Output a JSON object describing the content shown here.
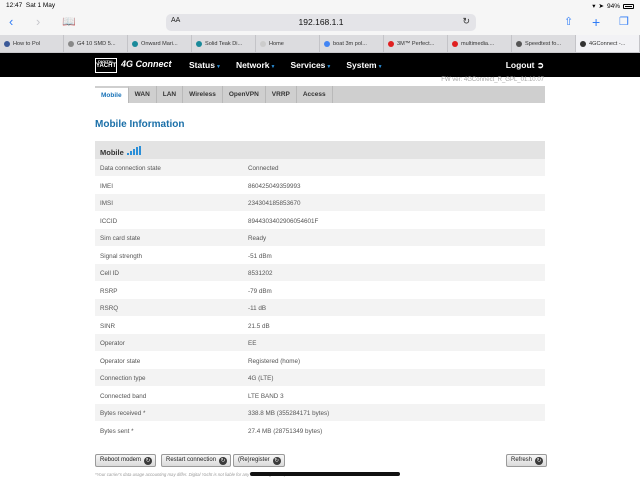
{
  "status_bar": {
    "time": "12:47",
    "date": "Sat 1 May",
    "battery": "94%"
  },
  "browser": {
    "text_size_label": "AA",
    "url": "192.168.1.1",
    "tabs": [
      {
        "label": "How to Pol",
        "color": "#3b5998"
      },
      {
        "label": "G4 10 SMD 5...",
        "color": "#888888"
      },
      {
        "label": "Onward Mari...",
        "color": "#1a8a9a"
      },
      {
        "label": "Solid Teak Di...",
        "color": "#1a8a9a"
      },
      {
        "label": "Home",
        "color": "#cccccc"
      },
      {
        "label": "boat 3m pol...",
        "color": "#4285f4"
      },
      {
        "label": "3M™ Perfect...",
        "color": "#e02020"
      },
      {
        "label": "multimedia....",
        "color": "#e02020"
      },
      {
        "label": "Speedtest fo...",
        "color": "#555555"
      },
      {
        "label": "4GConnect -...",
        "color": "#333333"
      }
    ]
  },
  "router": {
    "logo_top": "DIGITAL",
    "logo_bottom": "YACHT",
    "brand": "4G Connect",
    "menu": [
      "Status",
      "Network",
      "Services",
      "System"
    ],
    "logout": "Logout",
    "firmware": "FW ver: 4GConnect_R_GPL_01.10.07",
    "tabs": [
      "Mobile",
      "WAN",
      "LAN",
      "Wireless",
      "OpenVPN",
      "VRRP",
      "Access"
    ],
    "title": "Mobile Information",
    "section_label": "Mobile",
    "rows": [
      {
        "key": "Data connection state",
        "value": "Connected"
      },
      {
        "key": "IMEI",
        "value": "860425049359993"
      },
      {
        "key": "IMSI",
        "value": "234304185853670"
      },
      {
        "key": "ICCID",
        "value": "894430340290605460​1F"
      },
      {
        "key": "Sim card state",
        "value": "Ready"
      },
      {
        "key": "Signal strength",
        "value": "-51 dBm"
      },
      {
        "key": "Cell ID",
        "value": "8531202"
      },
      {
        "key": "RSRP",
        "value": "-79 dBm"
      },
      {
        "key": "RSRQ",
        "value": "-11 dB"
      },
      {
        "key": "SINR",
        "value": "21.5 dB"
      },
      {
        "key": "Operator",
        "value": "EE"
      },
      {
        "key": "Operator state",
        "value": "Registered (home)"
      },
      {
        "key": "Connection type",
        "value": "4G (LTE)"
      },
      {
        "key": "Connected band",
        "value": "LTE BAND 3"
      },
      {
        "key": "Bytes received *",
        "value": "338.8 MB (355284171 bytes)"
      },
      {
        "key": "Bytes sent *",
        "value": "27.4 MB (28751349 bytes)"
      }
    ],
    "buttons": {
      "reboot": "Reboot modem",
      "restart": "Restart connection",
      "reregister": "(Re)register",
      "refresh": "Refresh"
    },
    "footnote": "*Your carrier's data usage accounting may differ. Digital Yacht is not liable for any accounting discrepancies."
  }
}
